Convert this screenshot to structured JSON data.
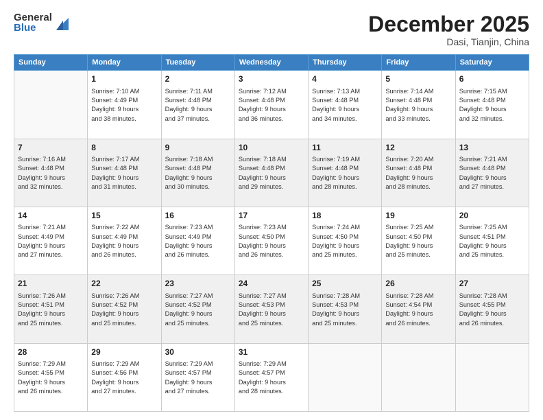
{
  "logo": {
    "general": "General",
    "blue": "Blue"
  },
  "header": {
    "month": "December 2025",
    "location": "Dasi, Tianjin, China"
  },
  "days_of_week": [
    "Sunday",
    "Monday",
    "Tuesday",
    "Wednesday",
    "Thursday",
    "Friday",
    "Saturday"
  ],
  "weeks": [
    [
      {
        "day": "",
        "lines": []
      },
      {
        "day": "1",
        "lines": [
          "Sunrise: 7:10 AM",
          "Sunset: 4:49 PM",
          "Daylight: 9 hours",
          "and 38 minutes."
        ]
      },
      {
        "day": "2",
        "lines": [
          "Sunrise: 7:11 AM",
          "Sunset: 4:48 PM",
          "Daylight: 9 hours",
          "and 37 minutes."
        ]
      },
      {
        "day": "3",
        "lines": [
          "Sunrise: 7:12 AM",
          "Sunset: 4:48 PM",
          "Daylight: 9 hours",
          "and 36 minutes."
        ]
      },
      {
        "day": "4",
        "lines": [
          "Sunrise: 7:13 AM",
          "Sunset: 4:48 PM",
          "Daylight: 9 hours",
          "and 34 minutes."
        ]
      },
      {
        "day": "5",
        "lines": [
          "Sunrise: 7:14 AM",
          "Sunset: 4:48 PM",
          "Daylight: 9 hours",
          "and 33 minutes."
        ]
      },
      {
        "day": "6",
        "lines": [
          "Sunrise: 7:15 AM",
          "Sunset: 4:48 PM",
          "Daylight: 9 hours",
          "and 32 minutes."
        ]
      }
    ],
    [
      {
        "day": "7",
        "lines": [
          "Sunrise: 7:16 AM",
          "Sunset: 4:48 PM",
          "Daylight: 9 hours",
          "and 32 minutes."
        ]
      },
      {
        "day": "8",
        "lines": [
          "Sunrise: 7:17 AM",
          "Sunset: 4:48 PM",
          "Daylight: 9 hours",
          "and 31 minutes."
        ]
      },
      {
        "day": "9",
        "lines": [
          "Sunrise: 7:18 AM",
          "Sunset: 4:48 PM",
          "Daylight: 9 hours",
          "and 30 minutes."
        ]
      },
      {
        "day": "10",
        "lines": [
          "Sunrise: 7:18 AM",
          "Sunset: 4:48 PM",
          "Daylight: 9 hours",
          "and 29 minutes."
        ]
      },
      {
        "day": "11",
        "lines": [
          "Sunrise: 7:19 AM",
          "Sunset: 4:48 PM",
          "Daylight: 9 hours",
          "and 28 minutes."
        ]
      },
      {
        "day": "12",
        "lines": [
          "Sunrise: 7:20 AM",
          "Sunset: 4:48 PM",
          "Daylight: 9 hours",
          "and 28 minutes."
        ]
      },
      {
        "day": "13",
        "lines": [
          "Sunrise: 7:21 AM",
          "Sunset: 4:48 PM",
          "Daylight: 9 hours",
          "and 27 minutes."
        ]
      }
    ],
    [
      {
        "day": "14",
        "lines": [
          "Sunrise: 7:21 AM",
          "Sunset: 4:49 PM",
          "Daylight: 9 hours",
          "and 27 minutes."
        ]
      },
      {
        "day": "15",
        "lines": [
          "Sunrise: 7:22 AM",
          "Sunset: 4:49 PM",
          "Daylight: 9 hours",
          "and 26 minutes."
        ]
      },
      {
        "day": "16",
        "lines": [
          "Sunrise: 7:23 AM",
          "Sunset: 4:49 PM",
          "Daylight: 9 hours",
          "and 26 minutes."
        ]
      },
      {
        "day": "17",
        "lines": [
          "Sunrise: 7:23 AM",
          "Sunset: 4:50 PM",
          "Daylight: 9 hours",
          "and 26 minutes."
        ]
      },
      {
        "day": "18",
        "lines": [
          "Sunrise: 7:24 AM",
          "Sunset: 4:50 PM",
          "Daylight: 9 hours",
          "and 25 minutes."
        ]
      },
      {
        "day": "19",
        "lines": [
          "Sunrise: 7:25 AM",
          "Sunset: 4:50 PM",
          "Daylight: 9 hours",
          "and 25 minutes."
        ]
      },
      {
        "day": "20",
        "lines": [
          "Sunrise: 7:25 AM",
          "Sunset: 4:51 PM",
          "Daylight: 9 hours",
          "and 25 minutes."
        ]
      }
    ],
    [
      {
        "day": "21",
        "lines": [
          "Sunrise: 7:26 AM",
          "Sunset: 4:51 PM",
          "Daylight: 9 hours",
          "and 25 minutes."
        ]
      },
      {
        "day": "22",
        "lines": [
          "Sunrise: 7:26 AM",
          "Sunset: 4:52 PM",
          "Daylight: 9 hours",
          "and 25 minutes."
        ]
      },
      {
        "day": "23",
        "lines": [
          "Sunrise: 7:27 AM",
          "Sunset: 4:52 PM",
          "Daylight: 9 hours",
          "and 25 minutes."
        ]
      },
      {
        "day": "24",
        "lines": [
          "Sunrise: 7:27 AM",
          "Sunset: 4:53 PM",
          "Daylight: 9 hours",
          "and 25 minutes."
        ]
      },
      {
        "day": "25",
        "lines": [
          "Sunrise: 7:28 AM",
          "Sunset: 4:53 PM",
          "Daylight: 9 hours",
          "and 25 minutes."
        ]
      },
      {
        "day": "26",
        "lines": [
          "Sunrise: 7:28 AM",
          "Sunset: 4:54 PM",
          "Daylight: 9 hours",
          "and 26 minutes."
        ]
      },
      {
        "day": "27",
        "lines": [
          "Sunrise: 7:28 AM",
          "Sunset: 4:55 PM",
          "Daylight: 9 hours",
          "and 26 minutes."
        ]
      }
    ],
    [
      {
        "day": "28",
        "lines": [
          "Sunrise: 7:29 AM",
          "Sunset: 4:55 PM",
          "Daylight: 9 hours",
          "and 26 minutes."
        ]
      },
      {
        "day": "29",
        "lines": [
          "Sunrise: 7:29 AM",
          "Sunset: 4:56 PM",
          "Daylight: 9 hours",
          "and 27 minutes."
        ]
      },
      {
        "day": "30",
        "lines": [
          "Sunrise: 7:29 AM",
          "Sunset: 4:57 PM",
          "Daylight: 9 hours",
          "and 27 minutes."
        ]
      },
      {
        "day": "31",
        "lines": [
          "Sunrise: 7:29 AM",
          "Sunset: 4:57 PM",
          "Daylight: 9 hours",
          "and 28 minutes."
        ]
      },
      {
        "day": "",
        "lines": []
      },
      {
        "day": "",
        "lines": []
      },
      {
        "day": "",
        "lines": []
      }
    ]
  ]
}
